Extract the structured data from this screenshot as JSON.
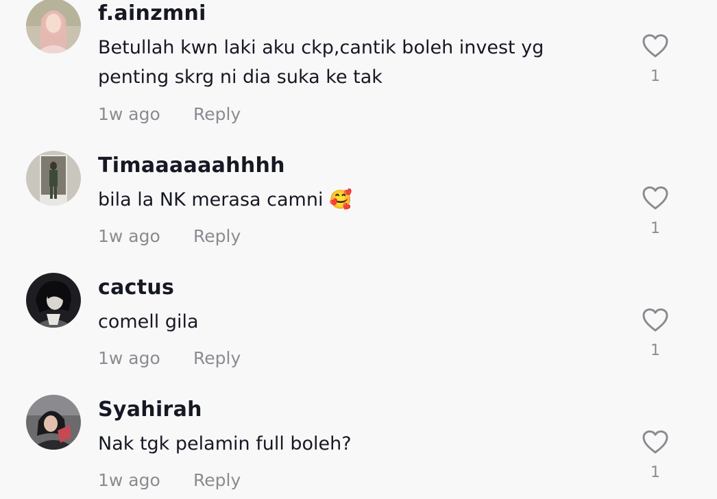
{
  "comments": [
    {
      "username": "f.ainzmni",
      "text": "Betullah kwn laki aku ckp,cantik boleh invest yg penting skrg ni dia suka ke tak",
      "time": "1w ago",
      "reply_label": "Reply",
      "likes": "1",
      "avatar": "user-avatar"
    },
    {
      "username": "Timaaaaaahhhh",
      "text": "bila la NK merasa camni 🥰",
      "time": "1w ago",
      "reply_label": "Reply",
      "likes": "1",
      "avatar": "user-avatar"
    },
    {
      "username": "cactus",
      "text": "comell gila",
      "time": "1w ago",
      "reply_label": "Reply",
      "likes": "1",
      "avatar": "user-avatar"
    },
    {
      "username": "Syahirah",
      "text": "Nak tgk pelamin full boleh?",
      "time": "1w ago",
      "reply_label": "Reply",
      "likes": "1",
      "avatar": "user-avatar"
    }
  ],
  "icons": {
    "like": "heart-outline-icon"
  },
  "colors": {
    "background": "#f8f8f8",
    "text": "#161823",
    "secondary_text": "#8a8b91",
    "icon": "#8a8b91"
  }
}
